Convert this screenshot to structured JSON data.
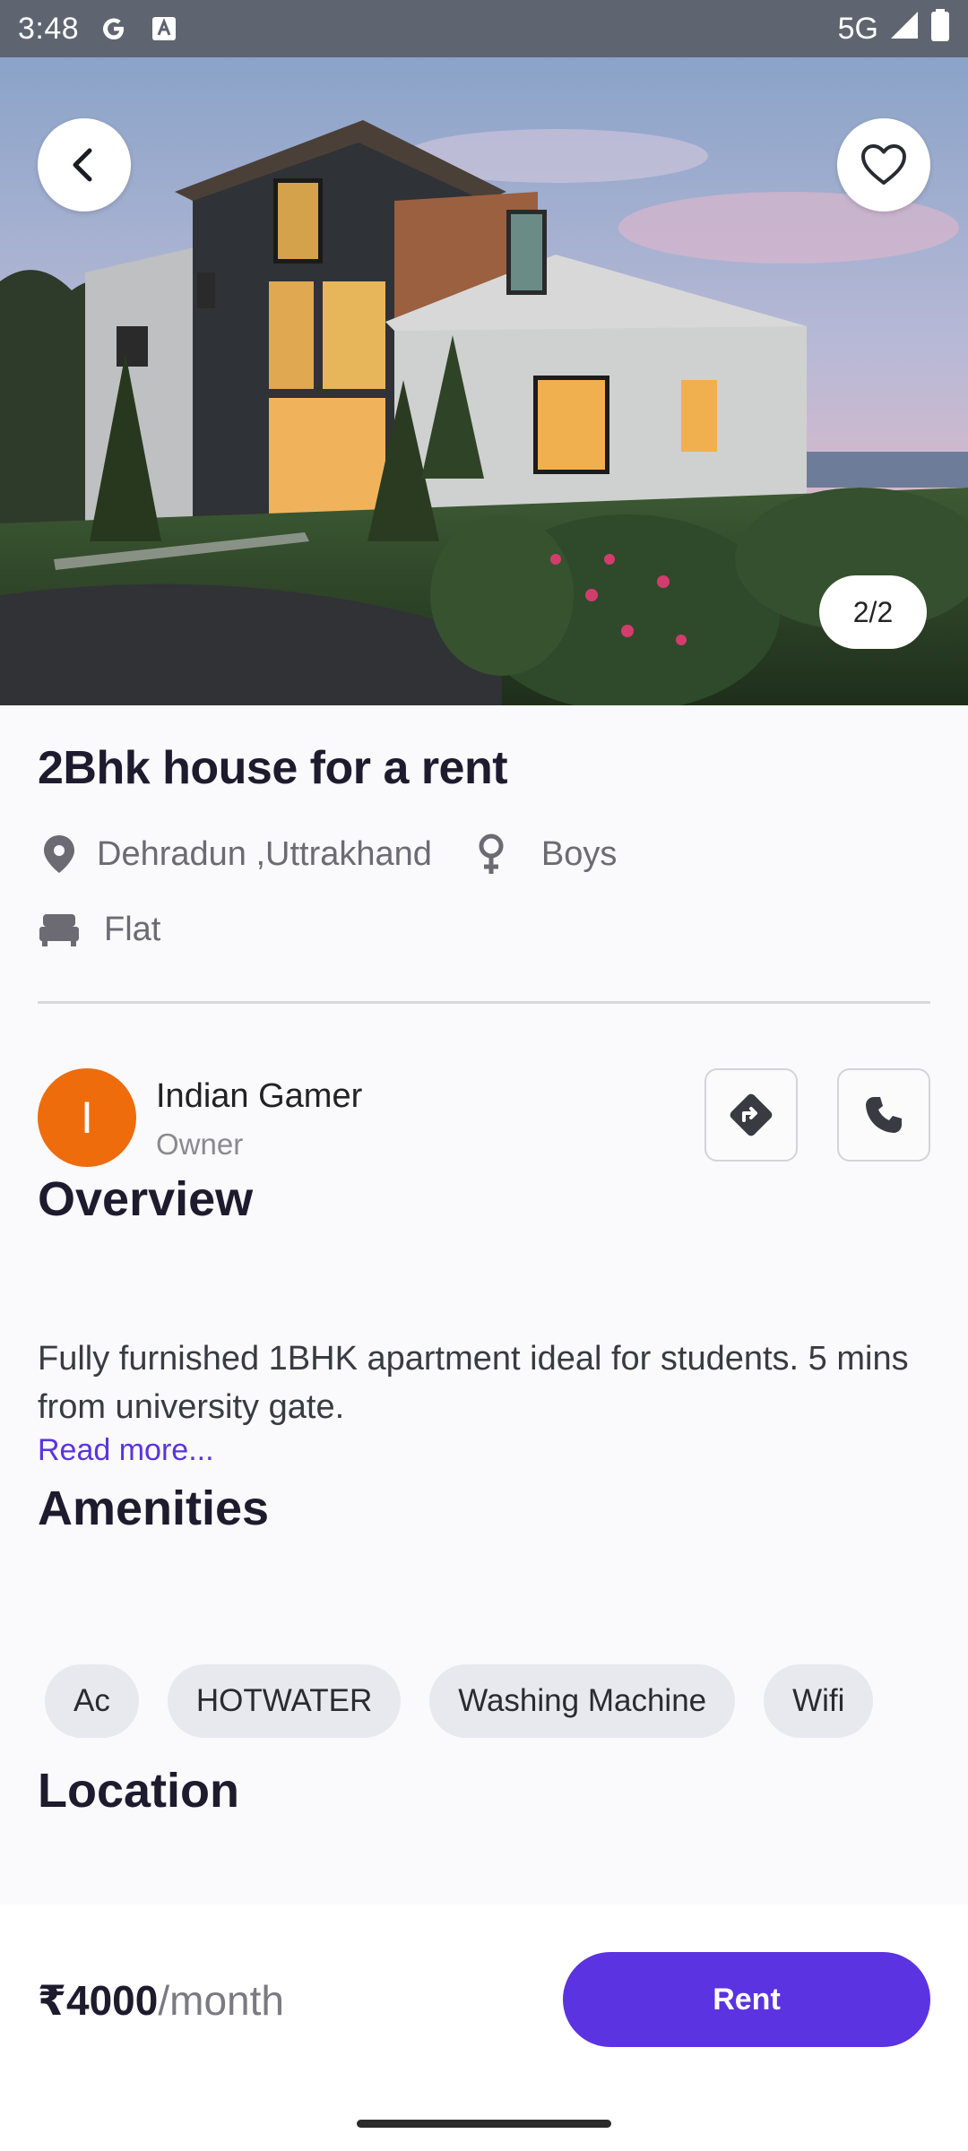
{
  "status_bar": {
    "time": "3:48",
    "network": "5G"
  },
  "gallery": {
    "counter": "2/2",
    "image_icon": "house-photo",
    "back_icon": "back-arrow-icon",
    "favorite_icon": "heart-outline-icon"
  },
  "listing": {
    "title": "2Bhk house for a rent",
    "location": "Dehradun ,Uttrakhand",
    "gender": "Boys",
    "type": "Flat"
  },
  "owner": {
    "initial": "I",
    "name": "Indian Gamer",
    "role": "Owner",
    "avatar_color": "#ee6c0c"
  },
  "overview": {
    "heading": "Overview",
    "text": "Fully furnished 1BHK apartment ideal for students. 5 mins from university gate.",
    "read_more": "Read more..."
  },
  "amenities": {
    "heading": "Amenities",
    "items": [
      "Ac",
      "HOTWATER",
      "Washing Machine",
      "Wifi"
    ]
  },
  "location": {
    "heading": "Location"
  },
  "footer": {
    "price": "₹4000",
    "per": "/month",
    "rent_label": "Rent",
    "accent_color": "#5b33e0"
  }
}
